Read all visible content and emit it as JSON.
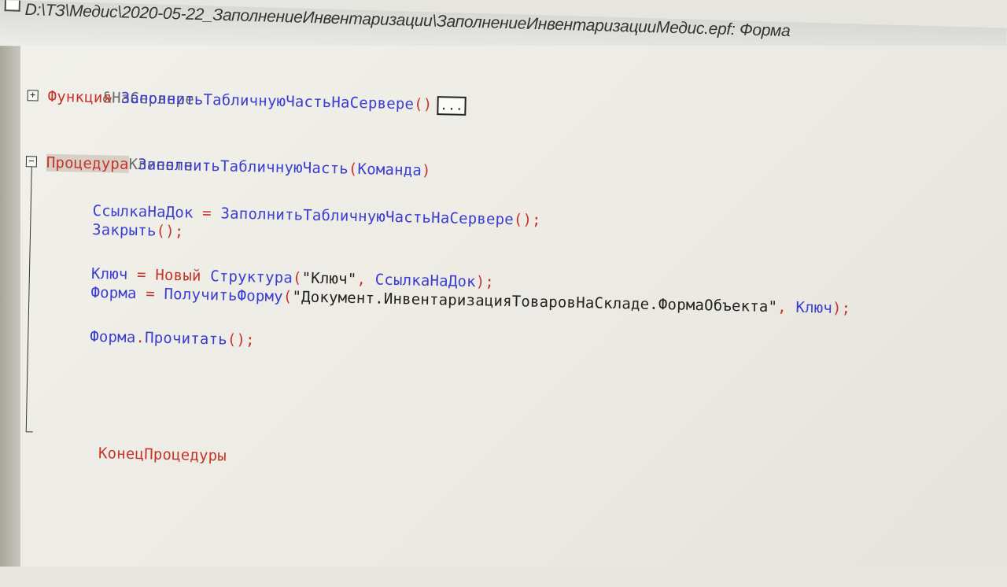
{
  "window": {
    "title": "D:\\ТЗ\\Медис\\2020-05-22_ЗаполнениеИнвентаризации\\ЗаполнениеИнвентаризацииМедис.epf: Форма"
  },
  "code": {
    "line1": "&НаСервере",
    "line2_kw": "Функция",
    "line2_name": "ЗаполнитьТабличнуюЧастьНаСервере",
    "line2_parens": "()",
    "line2_box": "...",
    "line3": "&НаКлиенте",
    "line4_kw": "Процедура",
    "line4_name": "ЗаполнитьТабличнуюЧасть",
    "line4_open": "(",
    "line4_param": "Команда",
    "line4_close": ")",
    "line5_var": "СсылкаНаДок",
    "line5_eq": " = ",
    "line5_call": "ЗаполнитьТабличнуюЧастьНаСервере",
    "line5_end": "();",
    "line6_call": "Закрыть",
    "line6_end": "();",
    "line7_var": "Ключ",
    "line7_eq": " = ",
    "line7_new": "Новый",
    "line7_type": "Структура",
    "line7_open": "(",
    "line7_str": "\"Ключ\"",
    "line7_comma": ", ",
    "line7_arg": "СсылкаНаДок",
    "line7_end": ");",
    "line8_var": "Форма",
    "line8_eq": " = ",
    "line8_call": "ПолучитьФорму",
    "line8_open": "(",
    "line8_str": "\"Документ.ИнвентаризацияТоваровНаСкладе.ФормаОбъекта\"",
    "line8_comma": ", ",
    "line8_arg": "Ключ",
    "line8_end": ");",
    "line9_obj": "Форма",
    "line9_dot": ".",
    "line9_call": "Прочитать",
    "line9_end": "();",
    "line10": "КонецПроцедуры",
    "fold_plus": "+",
    "fold_minus": "−"
  }
}
